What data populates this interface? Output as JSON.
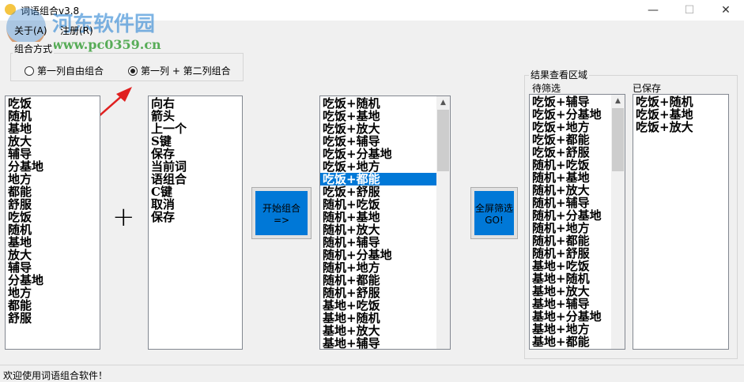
{
  "window": {
    "title": "词语组合v3.8",
    "minimize": "—",
    "maximize": "☐",
    "close": "✕"
  },
  "watermark": {
    "name": "河东软件园",
    "url": "www.pc0359.cn"
  },
  "menu": [
    "关于(A)",
    "注册(R)"
  ],
  "mode_group": {
    "label": "组合方式",
    "options": [
      {
        "label": "第一列自由组合",
        "checked": false
      },
      {
        "label": "第一列 + 第二列组合",
        "checked": true
      }
    ]
  },
  "list1": [
    "吃饭",
    "随机",
    "基地",
    "放大",
    "辅导",
    "分基地",
    "地方",
    "都能",
    "舒服",
    "吃饭",
    "随机",
    "基地",
    "放大",
    "辅导",
    "分基地",
    "地方",
    "都能",
    "舒服"
  ],
  "plus": "+",
  "list2": [
    "向右",
    "箭头",
    "上一个",
    "S键",
    "保存",
    "当前词",
    "语组合",
    "C键",
    "取消",
    "保存"
  ],
  "start_button": "开始组合=>",
  "combined": {
    "selected_index": 6,
    "items": [
      "吃饭+随机",
      "吃饭+基地",
      "吃饭+放大",
      "吃饭+辅导",
      "吃饭+分基地",
      "吃饭+地方",
      "吃饭+都能",
      "吃饭+舒服",
      "随机+吃饭",
      "随机+基地",
      "随机+放大",
      "随机+辅导",
      "随机+分基地",
      "随机+地方",
      "随机+都能",
      "随机+舒服",
      "基地+吃饭",
      "基地+随机",
      "基地+放大",
      "基地+辅导"
    ]
  },
  "filter_button": {
    "line1": "全屏筛选",
    "line2": "GO!"
  },
  "result_group": {
    "label": "结果查看区域",
    "pending_label": "待筛选",
    "saved_label": "已保存",
    "pending": [
      "吃饭+辅导",
      "吃饭+分基地",
      "吃饭+地方",
      "吃饭+都能",
      "吃饭+舒服",
      "随机+吃饭",
      "随机+基地",
      "随机+放大",
      "随机+辅导",
      "随机+分基地",
      "随机+地方",
      "随机+都能",
      "随机+舒服",
      "基地+吃饭",
      "基地+随机",
      "基地+放大",
      "基地+辅导",
      "基地+分基地",
      "基地+地方",
      "基地+都能"
    ],
    "saved": [
      "吃饭+随机",
      "吃饭+基地",
      "吃饭+放大"
    ]
  },
  "status": "欢迎使用词语组合软件！"
}
